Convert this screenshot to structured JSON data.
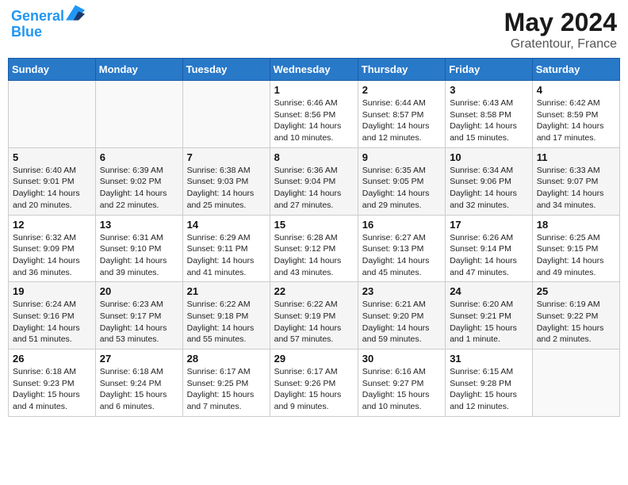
{
  "header": {
    "logo_line1": "General",
    "logo_line2": "Blue",
    "month_year": "May 2024",
    "location": "Gratentour, France"
  },
  "days_of_week": [
    "Sunday",
    "Monday",
    "Tuesday",
    "Wednesday",
    "Thursday",
    "Friday",
    "Saturday"
  ],
  "weeks": [
    [
      {
        "day": "",
        "info": ""
      },
      {
        "day": "",
        "info": ""
      },
      {
        "day": "",
        "info": ""
      },
      {
        "day": "1",
        "info": "Sunrise: 6:46 AM\nSunset: 8:56 PM\nDaylight: 14 hours\nand 10 minutes."
      },
      {
        "day": "2",
        "info": "Sunrise: 6:44 AM\nSunset: 8:57 PM\nDaylight: 14 hours\nand 12 minutes."
      },
      {
        "day": "3",
        "info": "Sunrise: 6:43 AM\nSunset: 8:58 PM\nDaylight: 14 hours\nand 15 minutes."
      },
      {
        "day": "4",
        "info": "Sunrise: 6:42 AM\nSunset: 8:59 PM\nDaylight: 14 hours\nand 17 minutes."
      }
    ],
    [
      {
        "day": "5",
        "info": "Sunrise: 6:40 AM\nSunset: 9:01 PM\nDaylight: 14 hours\nand 20 minutes."
      },
      {
        "day": "6",
        "info": "Sunrise: 6:39 AM\nSunset: 9:02 PM\nDaylight: 14 hours\nand 22 minutes."
      },
      {
        "day": "7",
        "info": "Sunrise: 6:38 AM\nSunset: 9:03 PM\nDaylight: 14 hours\nand 25 minutes."
      },
      {
        "day": "8",
        "info": "Sunrise: 6:36 AM\nSunset: 9:04 PM\nDaylight: 14 hours\nand 27 minutes."
      },
      {
        "day": "9",
        "info": "Sunrise: 6:35 AM\nSunset: 9:05 PM\nDaylight: 14 hours\nand 29 minutes."
      },
      {
        "day": "10",
        "info": "Sunrise: 6:34 AM\nSunset: 9:06 PM\nDaylight: 14 hours\nand 32 minutes."
      },
      {
        "day": "11",
        "info": "Sunrise: 6:33 AM\nSunset: 9:07 PM\nDaylight: 14 hours\nand 34 minutes."
      }
    ],
    [
      {
        "day": "12",
        "info": "Sunrise: 6:32 AM\nSunset: 9:09 PM\nDaylight: 14 hours\nand 36 minutes."
      },
      {
        "day": "13",
        "info": "Sunrise: 6:31 AM\nSunset: 9:10 PM\nDaylight: 14 hours\nand 39 minutes."
      },
      {
        "day": "14",
        "info": "Sunrise: 6:29 AM\nSunset: 9:11 PM\nDaylight: 14 hours\nand 41 minutes."
      },
      {
        "day": "15",
        "info": "Sunrise: 6:28 AM\nSunset: 9:12 PM\nDaylight: 14 hours\nand 43 minutes."
      },
      {
        "day": "16",
        "info": "Sunrise: 6:27 AM\nSunset: 9:13 PM\nDaylight: 14 hours\nand 45 minutes."
      },
      {
        "day": "17",
        "info": "Sunrise: 6:26 AM\nSunset: 9:14 PM\nDaylight: 14 hours\nand 47 minutes."
      },
      {
        "day": "18",
        "info": "Sunrise: 6:25 AM\nSunset: 9:15 PM\nDaylight: 14 hours\nand 49 minutes."
      }
    ],
    [
      {
        "day": "19",
        "info": "Sunrise: 6:24 AM\nSunset: 9:16 PM\nDaylight: 14 hours\nand 51 minutes."
      },
      {
        "day": "20",
        "info": "Sunrise: 6:23 AM\nSunset: 9:17 PM\nDaylight: 14 hours\nand 53 minutes."
      },
      {
        "day": "21",
        "info": "Sunrise: 6:22 AM\nSunset: 9:18 PM\nDaylight: 14 hours\nand 55 minutes."
      },
      {
        "day": "22",
        "info": "Sunrise: 6:22 AM\nSunset: 9:19 PM\nDaylight: 14 hours\nand 57 minutes."
      },
      {
        "day": "23",
        "info": "Sunrise: 6:21 AM\nSunset: 9:20 PM\nDaylight: 14 hours\nand 59 minutes."
      },
      {
        "day": "24",
        "info": "Sunrise: 6:20 AM\nSunset: 9:21 PM\nDaylight: 15 hours\nand 1 minute."
      },
      {
        "day": "25",
        "info": "Sunrise: 6:19 AM\nSunset: 9:22 PM\nDaylight: 15 hours\nand 2 minutes."
      }
    ],
    [
      {
        "day": "26",
        "info": "Sunrise: 6:18 AM\nSunset: 9:23 PM\nDaylight: 15 hours\nand 4 minutes."
      },
      {
        "day": "27",
        "info": "Sunrise: 6:18 AM\nSunset: 9:24 PM\nDaylight: 15 hours\nand 6 minutes."
      },
      {
        "day": "28",
        "info": "Sunrise: 6:17 AM\nSunset: 9:25 PM\nDaylight: 15 hours\nand 7 minutes."
      },
      {
        "day": "29",
        "info": "Sunrise: 6:17 AM\nSunset: 9:26 PM\nDaylight: 15 hours\nand 9 minutes."
      },
      {
        "day": "30",
        "info": "Sunrise: 6:16 AM\nSunset: 9:27 PM\nDaylight: 15 hours\nand 10 minutes."
      },
      {
        "day": "31",
        "info": "Sunrise: 6:15 AM\nSunset: 9:28 PM\nDaylight: 15 hours\nand 12 minutes."
      },
      {
        "day": "",
        "info": ""
      }
    ]
  ]
}
